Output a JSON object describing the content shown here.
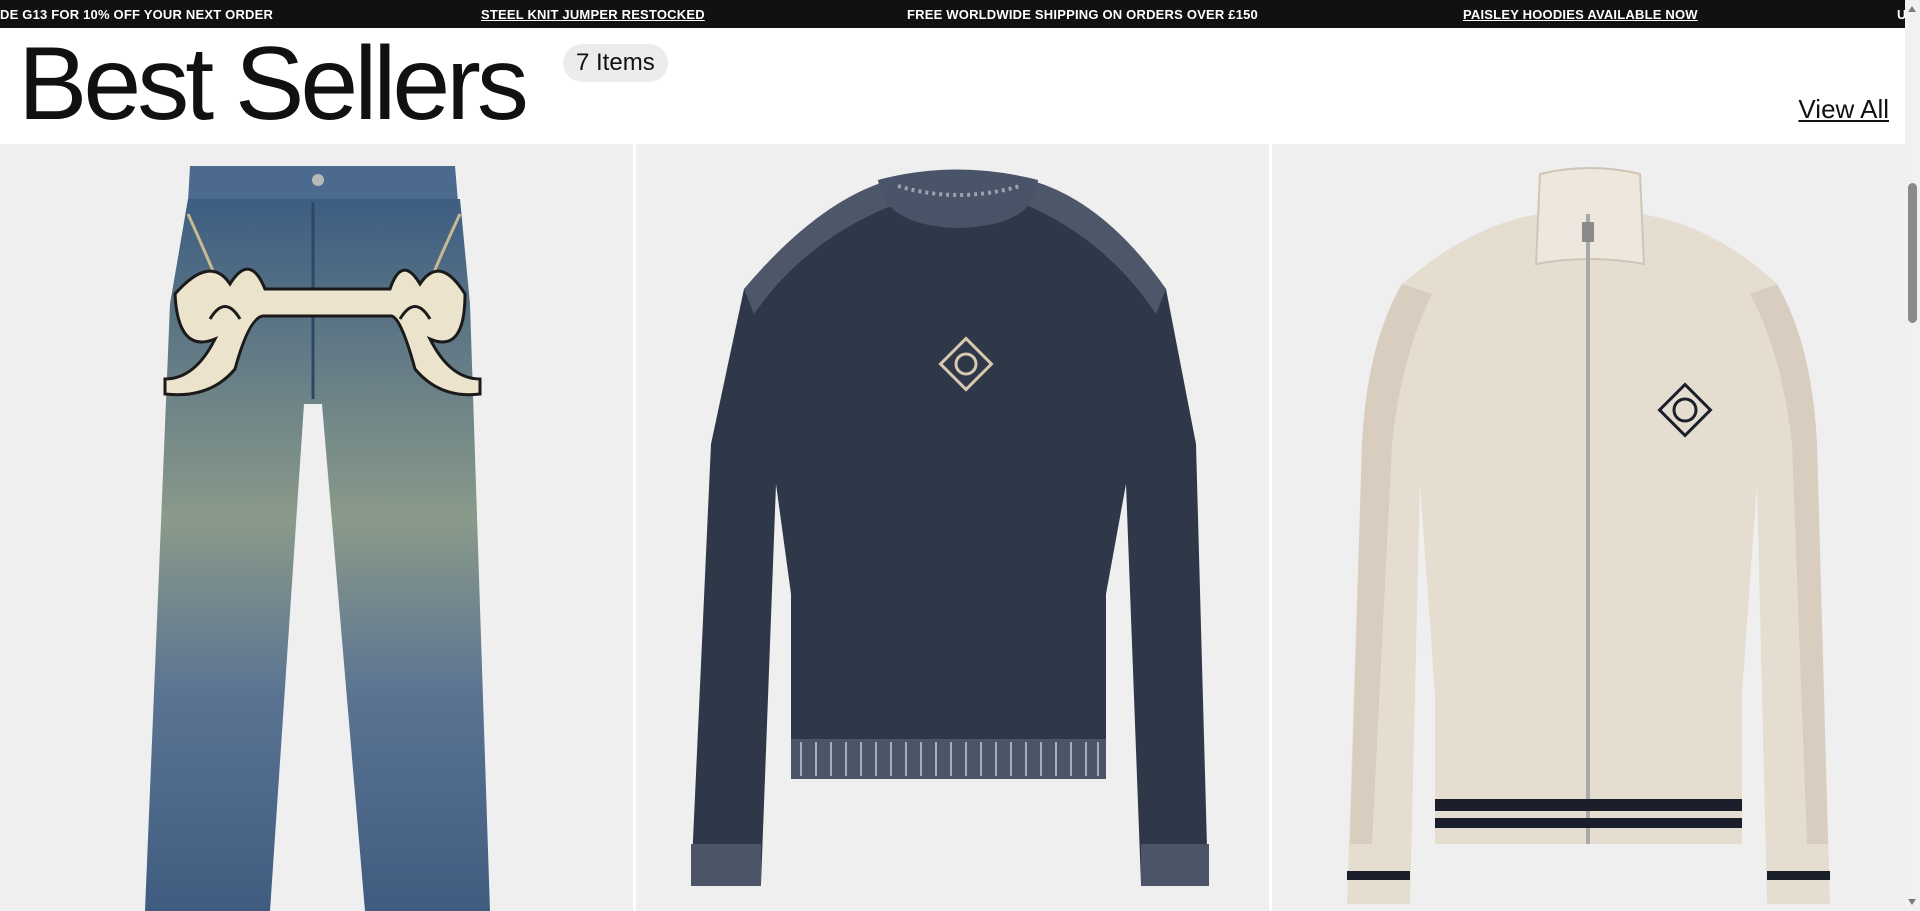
{
  "announcement_bar": {
    "items": [
      "DE G13 FOR 10% OFF YOUR NEXT ORDER",
      "STEEL KNIT JUMPER RESTOCKED",
      "FREE WORLDWIDE SHIPPING ON ORDERS OVER £150",
      "PAISLEY HOODIES AVAILABLE NOW",
      "U"
    ]
  },
  "section": {
    "title": "Best Sellers",
    "count": "7 Items",
    "view_all": "View All"
  },
  "products": [
    {
      "icon": "denim-jeans-image"
    },
    {
      "icon": "knit-jumper-image"
    },
    {
      "icon": "track-jacket-image"
    }
  ],
  "colors": {
    "bar_bg": "#111111",
    "card_bg": "#efefef",
    "denim": "#4a6688",
    "knit_navy": "#2e3646",
    "jacket_cream": "#e8e0d6"
  }
}
